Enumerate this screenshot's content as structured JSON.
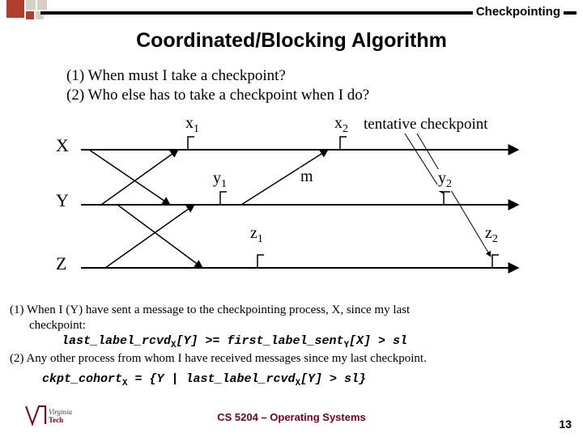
{
  "header": {
    "label": "Checkpointing"
  },
  "title": "Coordinated/Blocking Algorithm",
  "questions": {
    "q1": "(1) When must I take a checkpoint?",
    "q2": "(2) Who else has to take a checkpoint when I do?"
  },
  "diagram": {
    "processes": {
      "X": "X",
      "Y": "Y",
      "Z": "Z"
    },
    "labels": {
      "x1": "x",
      "x1sub": "1",
      "x2": "x",
      "x2sub": "2",
      "tentative": "tentative checkpoint",
      "y1": "y",
      "y1sub": "1",
      "y2": "y",
      "y2sub": "2",
      "z1": "z",
      "z1sub": "1",
      "z2": "z",
      "z2sub": "2",
      "m": "m"
    }
  },
  "explain": {
    "line1a": "(1) When I (Y) have sent a message to the checkpointing process, X, since my last",
    "line1b": "checkpoint:",
    "cond1_pre": "last_label_rcvd",
    "cond1_sub1": "X",
    "cond1_mid1": "[Y] >= first_label_sent",
    "cond1_sub2": "Y",
    "cond1_end": "[X] > sl",
    "line2": "(2) Any other process from whom I have received messages since my last checkpoint.",
    "cohort_pre": "ckpt_cohort",
    "cohort_sub1": "X",
    "cohort_mid": " = {Y | last_label_rcvd",
    "cohort_sub2": "X",
    "cohort_end": "[Y] > sl}"
  },
  "footer": {
    "course": "CS 5204 – Operating Systems",
    "page": "13",
    "logo_text1": "Virginia",
    "logo_text2": "Tech"
  }
}
